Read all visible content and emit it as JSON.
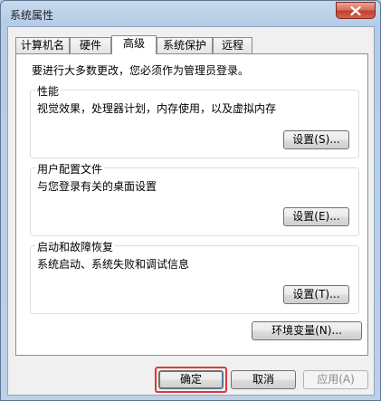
{
  "window": {
    "title": "系统属性"
  },
  "tabs": [
    {
      "label": "计算机名"
    },
    {
      "label": "硬件"
    },
    {
      "label": "高级"
    },
    {
      "label": "系统保护"
    },
    {
      "label": "远程"
    }
  ],
  "panel": {
    "intro": "要进行大多数更改，您必须作为管理员登录。",
    "performance": {
      "title": "性能",
      "desc": "视觉效果，处理器计划，内存使用，以及虚拟内存",
      "button": "设置(S)..."
    },
    "profiles": {
      "title": "用户配置文件",
      "desc": "与您登录有关的桌面设置",
      "button": "设置(E)..."
    },
    "startup": {
      "title": "启动和故障恢复",
      "desc": "系统启动、系统失败和调试信息",
      "button": "设置(T)..."
    },
    "env_button": "环境变量(N)..."
  },
  "footer": {
    "ok": "确定",
    "cancel": "取消",
    "apply": "应用(A)"
  },
  "colors": {
    "highlight": "#e0353a",
    "close_button": "#c3402b"
  },
  "icons": {
    "close": "close-icon"
  }
}
